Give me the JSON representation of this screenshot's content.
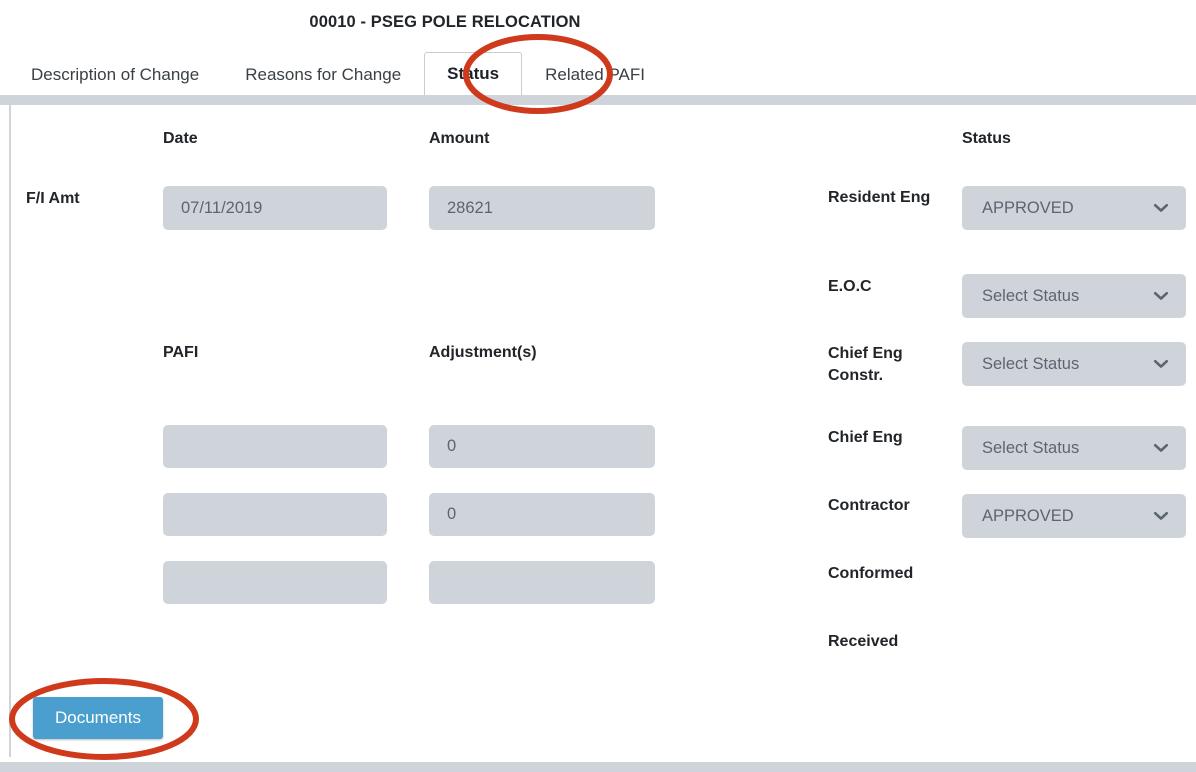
{
  "header": {
    "title": "00010 - PSEG POLE RELOCATION"
  },
  "tabs": [
    {
      "label": "Description of Change",
      "active": false
    },
    {
      "label": "Reasons for Change",
      "active": false
    },
    {
      "label": "Status",
      "active": true
    },
    {
      "label": "Related PAFI",
      "active": false
    }
  ],
  "left_panel": {
    "headings": {
      "date": "Date",
      "amount": "Amount",
      "pafi": "PAFI",
      "adjustments": "Adjustment(s)"
    },
    "fi_amt_label": "F/I Amt",
    "fi_amt": {
      "date_value": "07/11/2019",
      "amount_value": "28621"
    },
    "pafi_rows": [
      {
        "pafi_value": "",
        "adjustment_value": "0"
      },
      {
        "pafi_value": "",
        "adjustment_value": "0"
      },
      {
        "pafi_value": "",
        "adjustment_value": ""
      }
    ]
  },
  "status_panel": {
    "heading": "Status",
    "rows": [
      {
        "label": "Resident Eng",
        "value": "APPROVED",
        "has_select": true
      },
      {
        "label": "E.O.C",
        "value": "Select Status",
        "has_select": true
      },
      {
        "label": "Chief Eng Constr.",
        "value": "Select Status",
        "has_select": true
      },
      {
        "label": "Chief Eng",
        "value": "Select Status",
        "has_select": true
      },
      {
        "label": "Contractor",
        "value": "APPROVED",
        "has_select": true
      },
      {
        "label": "Conformed",
        "value": "",
        "has_select": false
      },
      {
        "label": "Received",
        "value": "",
        "has_select": false
      }
    ]
  },
  "footer": {
    "documents_label": "Documents"
  },
  "annotations": {
    "status_tab_highlight": "red-ellipse-annotation",
    "documents_highlight": "red-ellipse-annotation"
  },
  "colors": {
    "accent_button": "#4a9fcf",
    "field_background": "#ced4da",
    "annotation": "#cf3a1c",
    "text": "#212529"
  }
}
